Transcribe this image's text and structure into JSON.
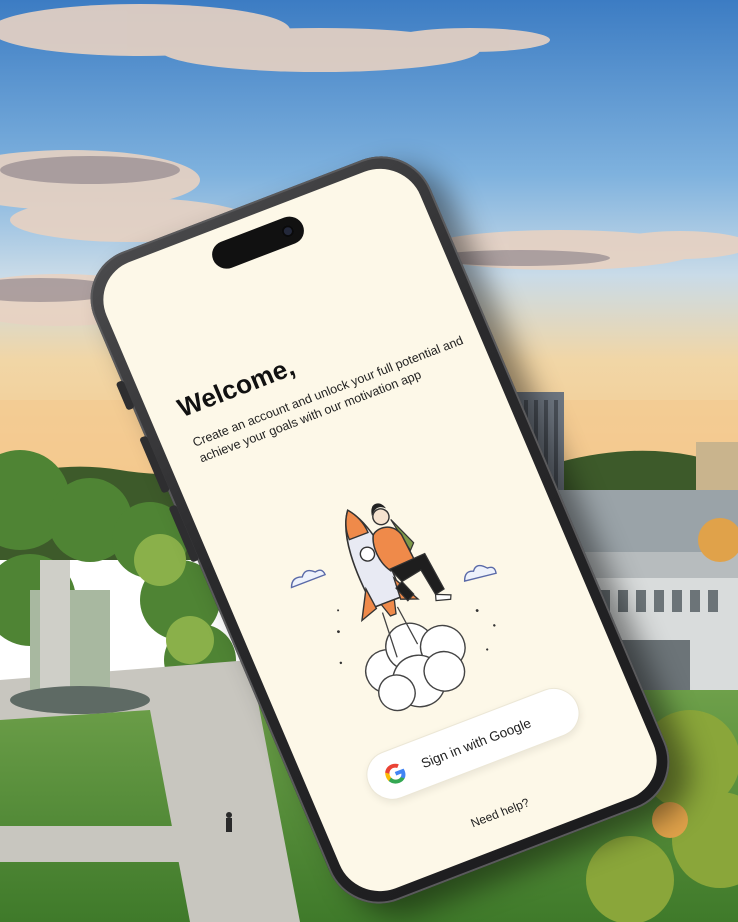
{
  "welcome": {
    "title": "Welcome,",
    "subtitle": "Create an account and unlock your full potential and achieve your goals with our motivation app"
  },
  "auth": {
    "google_button_label": "Sign in with Google",
    "help_link": "Need help?"
  },
  "icons": {
    "google": "google-g-icon",
    "illustration": "rocket-person-illustration"
  },
  "colors": {
    "screen_background": "#fdf8e8",
    "accent_orange": "#ef8a4a",
    "sky_top": "#3f7fc4",
    "sunset": "#f3c48a"
  }
}
